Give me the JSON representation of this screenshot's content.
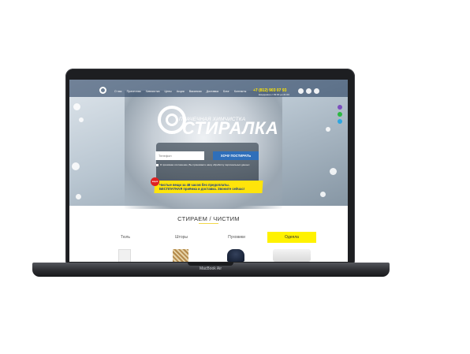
{
  "hero": {
    "menu": [
      "О нас",
      "Прачечная",
      "Химчистка",
      "Цены",
      "Акции",
      "Вакансии",
      "Доставка",
      "Блог",
      "Контакты"
    ],
    "phone": "+7 (812) 903 07 93",
    "hours": "Ежедневно с 09:00 до 21:00",
    "brand_subtitle": "ПРАЧЕЧНАЯ ХИМЧИСТКА",
    "brand_name": "СТИРАЛКА",
    "phone_placeholder": "Телефон",
    "cta_label": "ХОЧУ ПОСТИРАТЬ",
    "consent": "Я принимаю соглашение, Вы принимаете нашу обработку персональных данных",
    "promo_line1": "Чистые вещи за 48 часов без предоплаты.",
    "promo_line2": "БЕСПЛАТНАЯ приёмка и доставка. Звоните сейчас!",
    "badge": "акция"
  },
  "services": {
    "title": "СТИРАЕМ / ЧИСТИМ",
    "categories": [
      {
        "label": "Тюль",
        "active": false
      },
      {
        "label": "Шторы",
        "active": false
      },
      {
        "label": "Пуховики",
        "active": false
      },
      {
        "label": "Одеяла",
        "active": true
      }
    ]
  },
  "device": {
    "label": "MacBook Air"
  },
  "colors": {
    "accent_yellow": "#fff200",
    "cta_blue": "#2f6fba",
    "phone_yellow": "#ffe600"
  },
  "icons": {
    "messenger_dock": [
      "viber-icon",
      "whatsapp-icon",
      "telegram-icon"
    ],
    "social": [
      "vk-icon",
      "instagram-icon",
      "odnoklassniki-icon",
      "facebook-icon"
    ]
  }
}
